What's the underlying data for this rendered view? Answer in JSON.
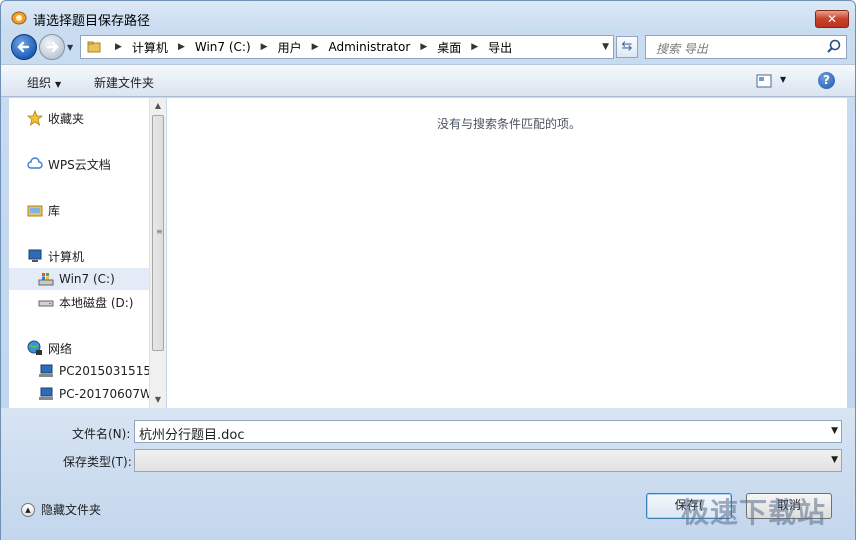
{
  "window": {
    "title": "请选择题目保存路径",
    "close_label": "✕"
  },
  "address": {
    "crumbs": [
      "计算机",
      "Win7 (C:)",
      "用户",
      "Administrator",
      "桌面",
      "导出"
    ]
  },
  "search": {
    "placeholder": "搜索 导出"
  },
  "toolbar": {
    "organize_label": "组织",
    "new_folder_label": "新建文件夹",
    "help_label": "?"
  },
  "sidebar": {
    "items": [
      {
        "label": "收藏夹",
        "icon": "star-icon"
      },
      {
        "label": "WPS云文档",
        "icon": "cloud-icon"
      },
      {
        "label": "库",
        "icon": "library-icon"
      },
      {
        "label": "计算机",
        "icon": "computer-icon"
      },
      {
        "label": "Win7 (C:)",
        "icon": "drive-icon",
        "selected": true
      },
      {
        "label": "本地磁盘 (D:)",
        "icon": "disk-icon"
      },
      {
        "label": "网络",
        "icon": "network-icon"
      },
      {
        "label": "PC2015031515",
        "icon": "pc-icon"
      },
      {
        "label": "PC-20170607W",
        "icon": "pc-icon"
      }
    ]
  },
  "files": {
    "empty_message": "没有与搜索条件匹配的项。"
  },
  "form": {
    "filename_label": "文件名(N):",
    "filename_value": "杭州分行题目.doc",
    "filetype_label": "保存类型(T):",
    "filetype_value": ""
  },
  "footer": {
    "hide_folders_label": "隐藏文件夹",
    "save_label": "保存(",
    "cancel_label": "取消"
  },
  "watermark": "极速下载站",
  "colors": {
    "accent": "#1f5fb8",
    "close": "#c7402a"
  }
}
